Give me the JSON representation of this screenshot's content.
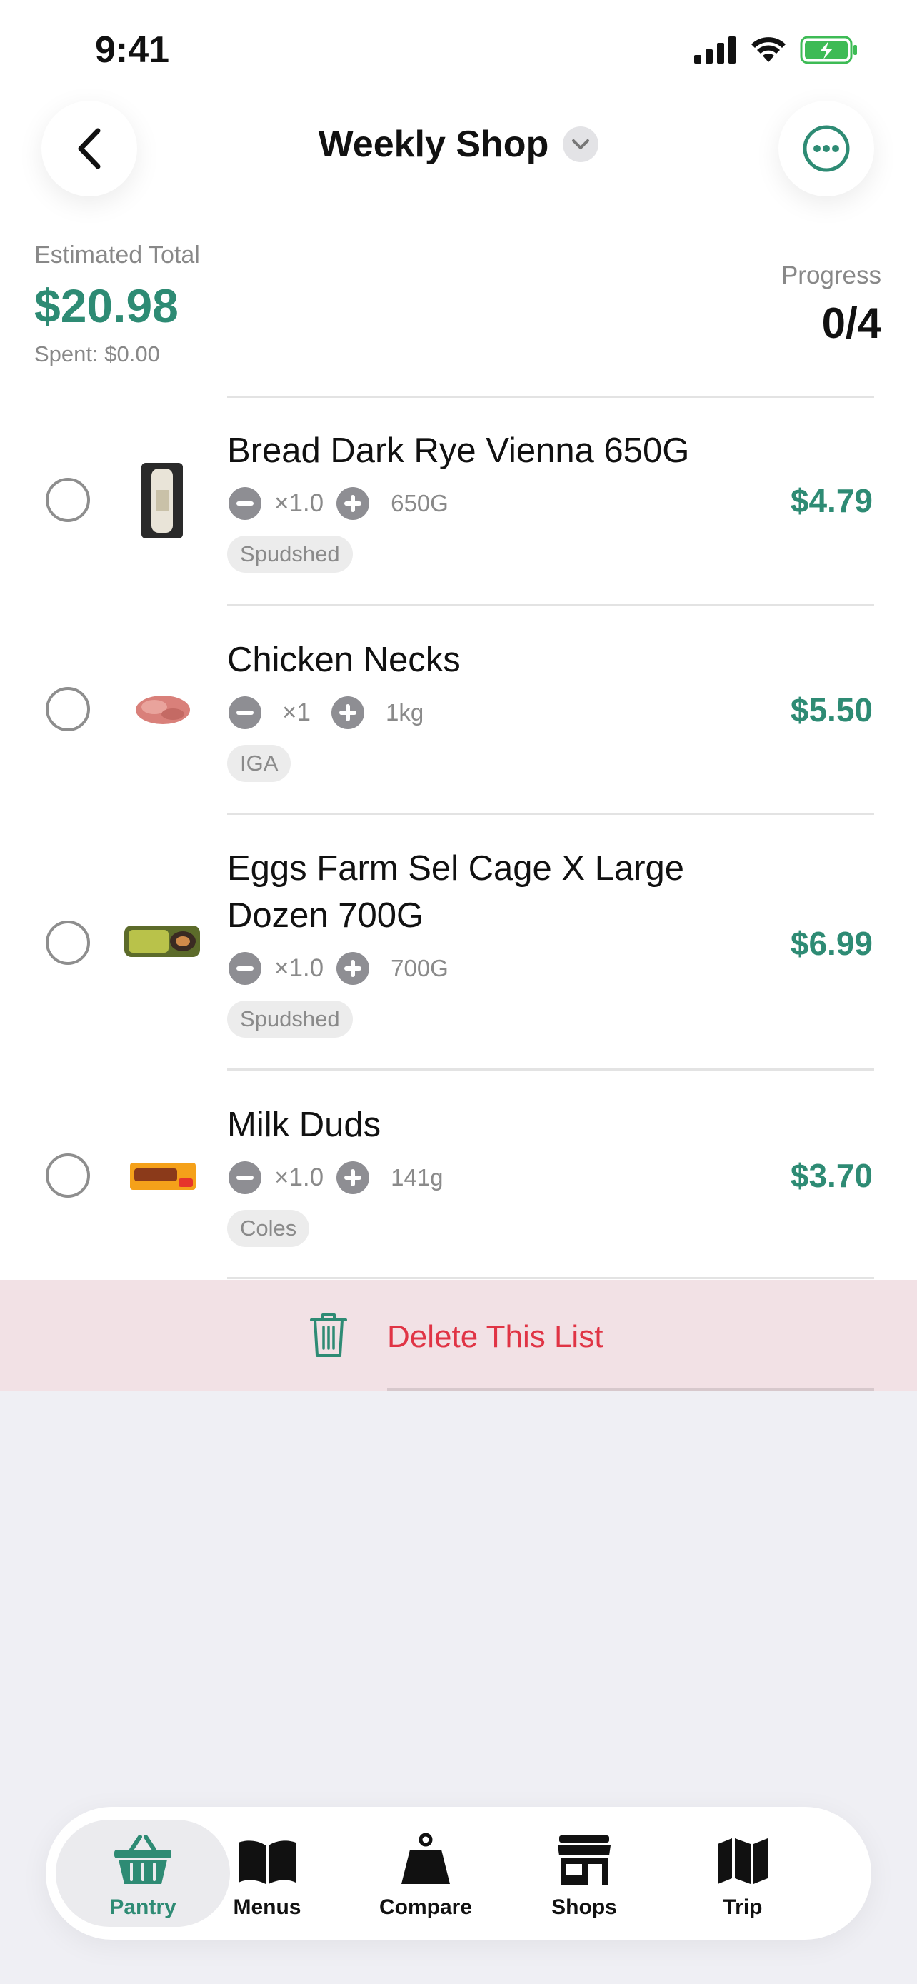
{
  "status_bar": {
    "time": "9:41"
  },
  "header": {
    "title": "Weekly Shop"
  },
  "summary": {
    "estimated_label": "Estimated Total",
    "estimated_value": "$20.98",
    "spent": "Spent: $0.00",
    "progress_label": "Progress",
    "progress_value": "0/4"
  },
  "items": [
    {
      "name": "Bread Dark Rye Vienna 650G",
      "qty": "×1.0",
      "unit": "650G",
      "store": "Spudshed",
      "price": "$4.79"
    },
    {
      "name": "Chicken Necks",
      "qty": "×1",
      "unit": "1kg",
      "store": "IGA",
      "price": "$5.50"
    },
    {
      "name": "Eggs Farm Sel Cage X Large Dozen 700G",
      "qty": "×1.0",
      "unit": "700G",
      "store": "Spudshed",
      "price": "$6.99"
    },
    {
      "name": "Milk Duds",
      "qty": "×1.0",
      "unit": "141g",
      "store": "Coles",
      "price": "$3.70"
    }
  ],
  "delete_label": "Delete This List",
  "tabs": [
    {
      "label": "Pantry",
      "icon": "basket-icon",
      "active": true
    },
    {
      "label": "Menus",
      "icon": "book-icon"
    },
    {
      "label": "Compare",
      "icon": "weight-icon"
    },
    {
      "label": "Shops",
      "icon": "store-icon"
    },
    {
      "label": "Trip",
      "icon": "map-icon"
    }
  ],
  "colors": {
    "accent": "#2e8b74",
    "danger": "#e03445"
  }
}
